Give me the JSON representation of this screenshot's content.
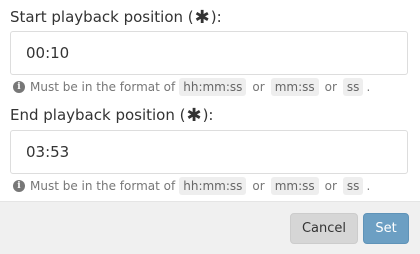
{
  "start": {
    "label_text": "Start playback position (",
    "label_suffix": "):",
    "required_mark": "✱",
    "value": "00:10",
    "help": {
      "info_glyph": "i",
      "prefix": "Must be in the format of",
      "formats": [
        "hh:mm:ss",
        "mm:ss",
        "ss"
      ],
      "or": "or",
      "end": "."
    }
  },
  "end": {
    "label_text": "End playback position (",
    "label_suffix": "):",
    "required_mark": "✱",
    "value": "03:53",
    "help": {
      "info_glyph": "i",
      "prefix": "Must be in the format of",
      "formats": [
        "hh:mm:ss",
        "mm:ss",
        "ss"
      ],
      "or": "or",
      "end": "."
    }
  },
  "footer": {
    "cancel_label": "Cancel",
    "set_label": "Set"
  },
  "colors": {
    "primary_button": "#6c9fc3",
    "cancel_button": "#d6d6d6",
    "footer_background": "#f0f0f0"
  }
}
